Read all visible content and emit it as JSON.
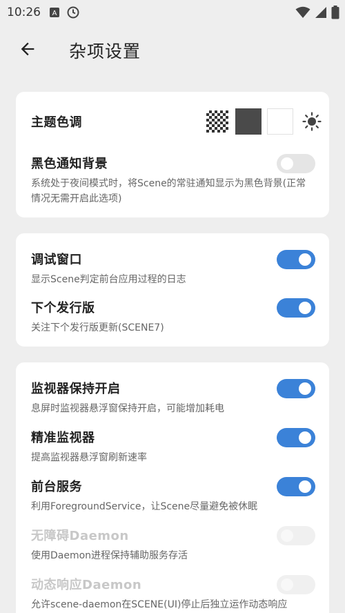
{
  "status_bar": {
    "time": "10:26",
    "icons": [
      "a-notification-icon",
      "clock-icon",
      "wifi-icon",
      "signal-icon",
      "battery-icon"
    ]
  },
  "app_bar": {
    "back_icon": "arrow-left-icon",
    "title": "杂项设置"
  },
  "colors": {
    "accent": "#3b82d8",
    "background": "#eeeeee",
    "card": "#ffffff"
  },
  "card1": {
    "theme": {
      "title": "主题色调",
      "swatches": [
        "checker",
        "dark",
        "light",
        "sun-icon"
      ]
    },
    "black_notification": {
      "title": "黑色通知背景",
      "desc": "系统处于夜间模式时，将Scene的常驻通知显示为黑色背景(正常情况无需开启此选项)",
      "state": "off"
    }
  },
  "card2": {
    "debug_window": {
      "title": "调试窗口",
      "desc": "显示Scene判定前台应用过程的日志",
      "state": "on"
    },
    "next_release": {
      "title": "下个发行版",
      "desc": "关注下个发行版更新(SCENE7)",
      "state": "on"
    }
  },
  "card3": {
    "monitor_keep": {
      "title": "监视器保持开启",
      "desc": "息屏时监视器悬浮窗保持开启，可能增加耗电",
      "state": "on"
    },
    "precise_monitor": {
      "title": "精准监视器",
      "desc": "提高监视器悬浮窗刷新速率",
      "state": "on"
    },
    "foreground_service": {
      "title": "前台服务",
      "desc": "利用ForegroundService，让Scene尽量避免被休眠",
      "state": "on"
    },
    "accessibility_daemon": {
      "title": "无障碍Daemon",
      "desc": "使用Daemon进程保持辅助服务存活",
      "state": "disabled"
    },
    "dynamic_daemon": {
      "title": "动态响应Daemon",
      "desc": "允许scene-daemon在SCENE(UI)停止后独立运作动态响应",
      "state": "disabled"
    }
  }
}
